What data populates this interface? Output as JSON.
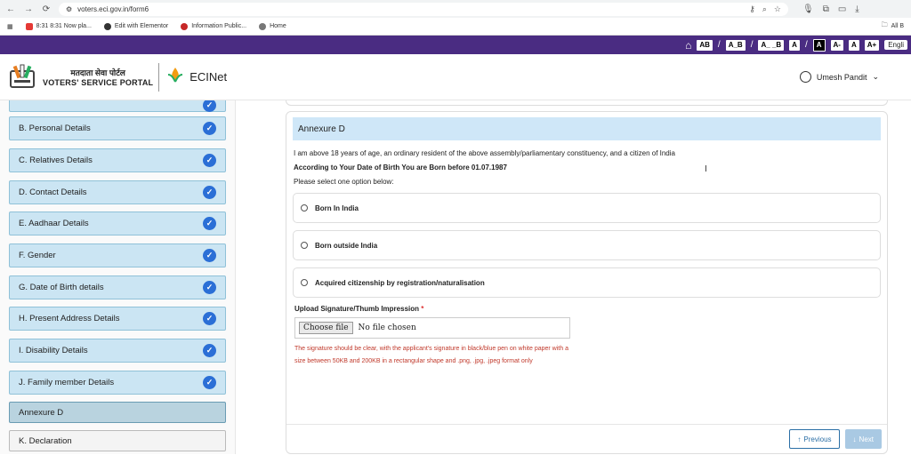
{
  "browser": {
    "url": "voters.eci.gov.in/form6",
    "bookmarks": [
      {
        "label": "8:31 8:31 Now pla...",
        "color": "#e53935"
      },
      {
        "label": "Edit with Elementor",
        "color": "#333333"
      },
      {
        "label": "Information Public...",
        "color": "#c62828"
      },
      {
        "label": "Home",
        "color": "#555555"
      }
    ],
    "all_bookmarks": "All B"
  },
  "accessibility": {
    "buttons": [
      "AB",
      "A_B",
      "A_ _B",
      "A",
      "A",
      "A-",
      "A",
      "A+"
    ],
    "language": "Engli"
  },
  "header": {
    "brand_hi": "मतदाता सेवा पोर्टल",
    "brand_en": "VOTERS' SERVICE PORTAL",
    "eci": "ECINet",
    "user_name": "Umesh Pandit"
  },
  "sidebar": {
    "items": [
      {
        "label": "",
        "state": "done"
      },
      {
        "label": "B. Personal Details",
        "state": "done"
      },
      {
        "label": "C. Relatives Details",
        "state": "done"
      },
      {
        "label": "D. Contact Details",
        "state": "done"
      },
      {
        "label": "E. Aadhaar Details",
        "state": "done"
      },
      {
        "label": "F. Gender",
        "state": "done"
      },
      {
        "label": "G. Date of Birth details",
        "state": "done"
      },
      {
        "label": "H. Present Address Details",
        "state": "done"
      },
      {
        "label": "I. Disability Details",
        "state": "done"
      },
      {
        "label": "J. Family member Details",
        "state": "done"
      },
      {
        "label": "Annexure D",
        "state": "active"
      },
      {
        "label": "K. Declaration",
        "state": "pending"
      }
    ]
  },
  "form": {
    "section_title": "Annexure D",
    "statement": "I am above 18 years of age, an ordinary resident of the above assembly/parliamentary constituency, and a citizen of India",
    "dob_note": "According to Your Date of Birth You are Born before 01.07.1987",
    "select_prompt": "Please select one option below:",
    "options": [
      "Born In India",
      "Born outside India",
      "Acquired citizenship by registration/naturalisation"
    ],
    "upload_label": "Upload Signature/Thumb Impression",
    "required_mark": "*",
    "file_button": "Choose file",
    "file_status": "No file chosen",
    "file_help": "The signature should be clear, with the applicant's signature in black/blue pen on white paper with a size between 50KB and 200KB in a rectangular shape and .png, .jpg, .jpeg format only",
    "prev_label": "Previous",
    "next_label": "Next"
  }
}
